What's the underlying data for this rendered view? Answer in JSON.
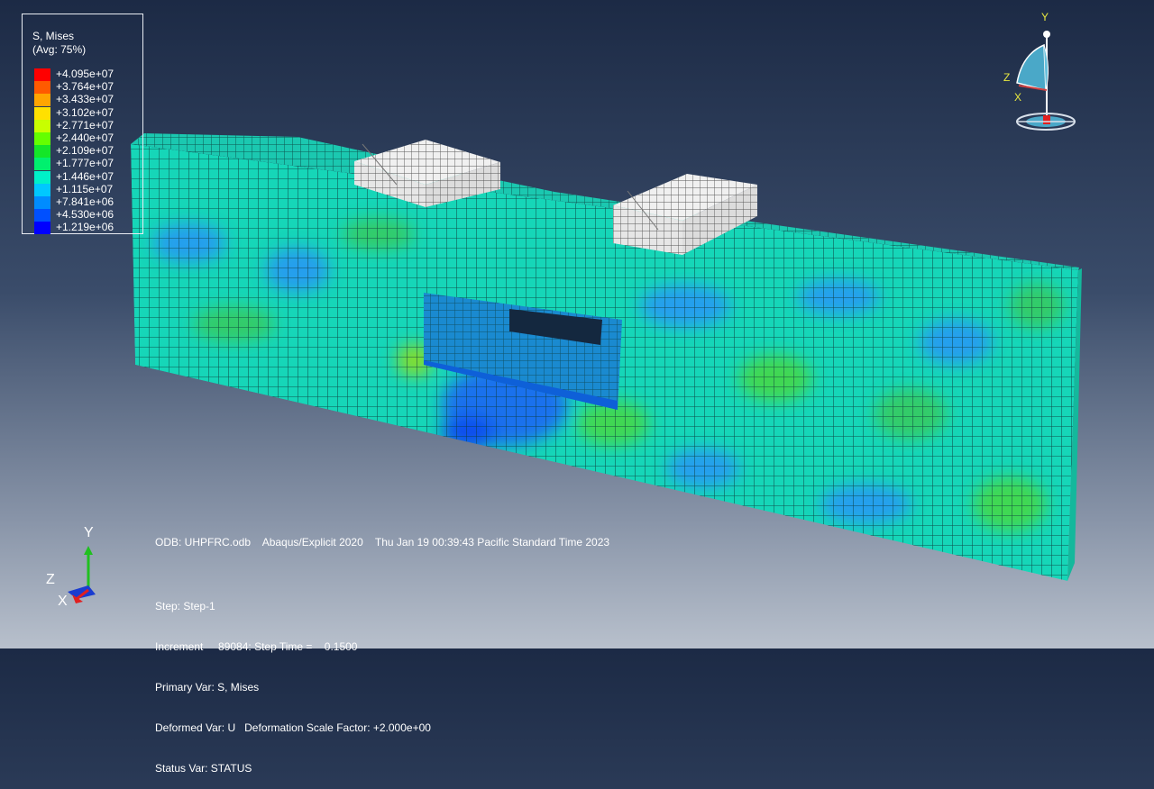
{
  "legend": {
    "title": "S, Mises",
    "subtitle": "(Avg: 75%)",
    "entries": [
      {
        "label": "+4.095e+07",
        "color": "#ff0000"
      },
      {
        "label": "+3.764e+07",
        "color": "#ff5a00"
      },
      {
        "label": "+3.433e+07",
        "color": "#ffa500"
      },
      {
        "label": "+3.102e+07",
        "color": "#ffe000"
      },
      {
        "label": "+2.771e+07",
        "color": "#c8ff00"
      },
      {
        "label": "+2.440e+07",
        "color": "#64ff00"
      },
      {
        "label": "+2.109e+07",
        "color": "#14e628"
      },
      {
        "label": "+1.777e+07",
        "color": "#00f06e"
      },
      {
        "label": "+1.446e+07",
        "color": "#00f0c8"
      },
      {
        "label": "+1.115e+07",
        "color": "#00c8ff"
      },
      {
        "label": "+7.841e+06",
        "color": "#008cff"
      },
      {
        "label": "+4.530e+06",
        "color": "#0050ff"
      },
      {
        "label": "+1.219e+06",
        "color": "#0000ff"
      }
    ]
  },
  "info": {
    "odb_line": "ODB: UHPFRC.odb    Abaqus/Explicit 2020    Thu Jan 19 00:39:43 Pacific Standard Time 2023",
    "step": "Step: Step-1",
    "increment": "Increment     89084: Step Time =    0.1500",
    "primary_var": "Primary Var: S, Mises",
    "deformed_var": "Deformed Var: U   Deformation Scale Factor: +2.000e+00",
    "status_var": "Status Var: STATUS"
  },
  "triad": {
    "view_axes": {
      "y": "Y",
      "z": "Z",
      "x": "X"
    },
    "corner_axes": {
      "y": "Y",
      "z": "Z",
      "x": "X"
    }
  },
  "colors": {
    "mesh_base": "#18d2b4",
    "mesh_lines": "#0a3c3c",
    "plate": "#e8e8e8"
  }
}
